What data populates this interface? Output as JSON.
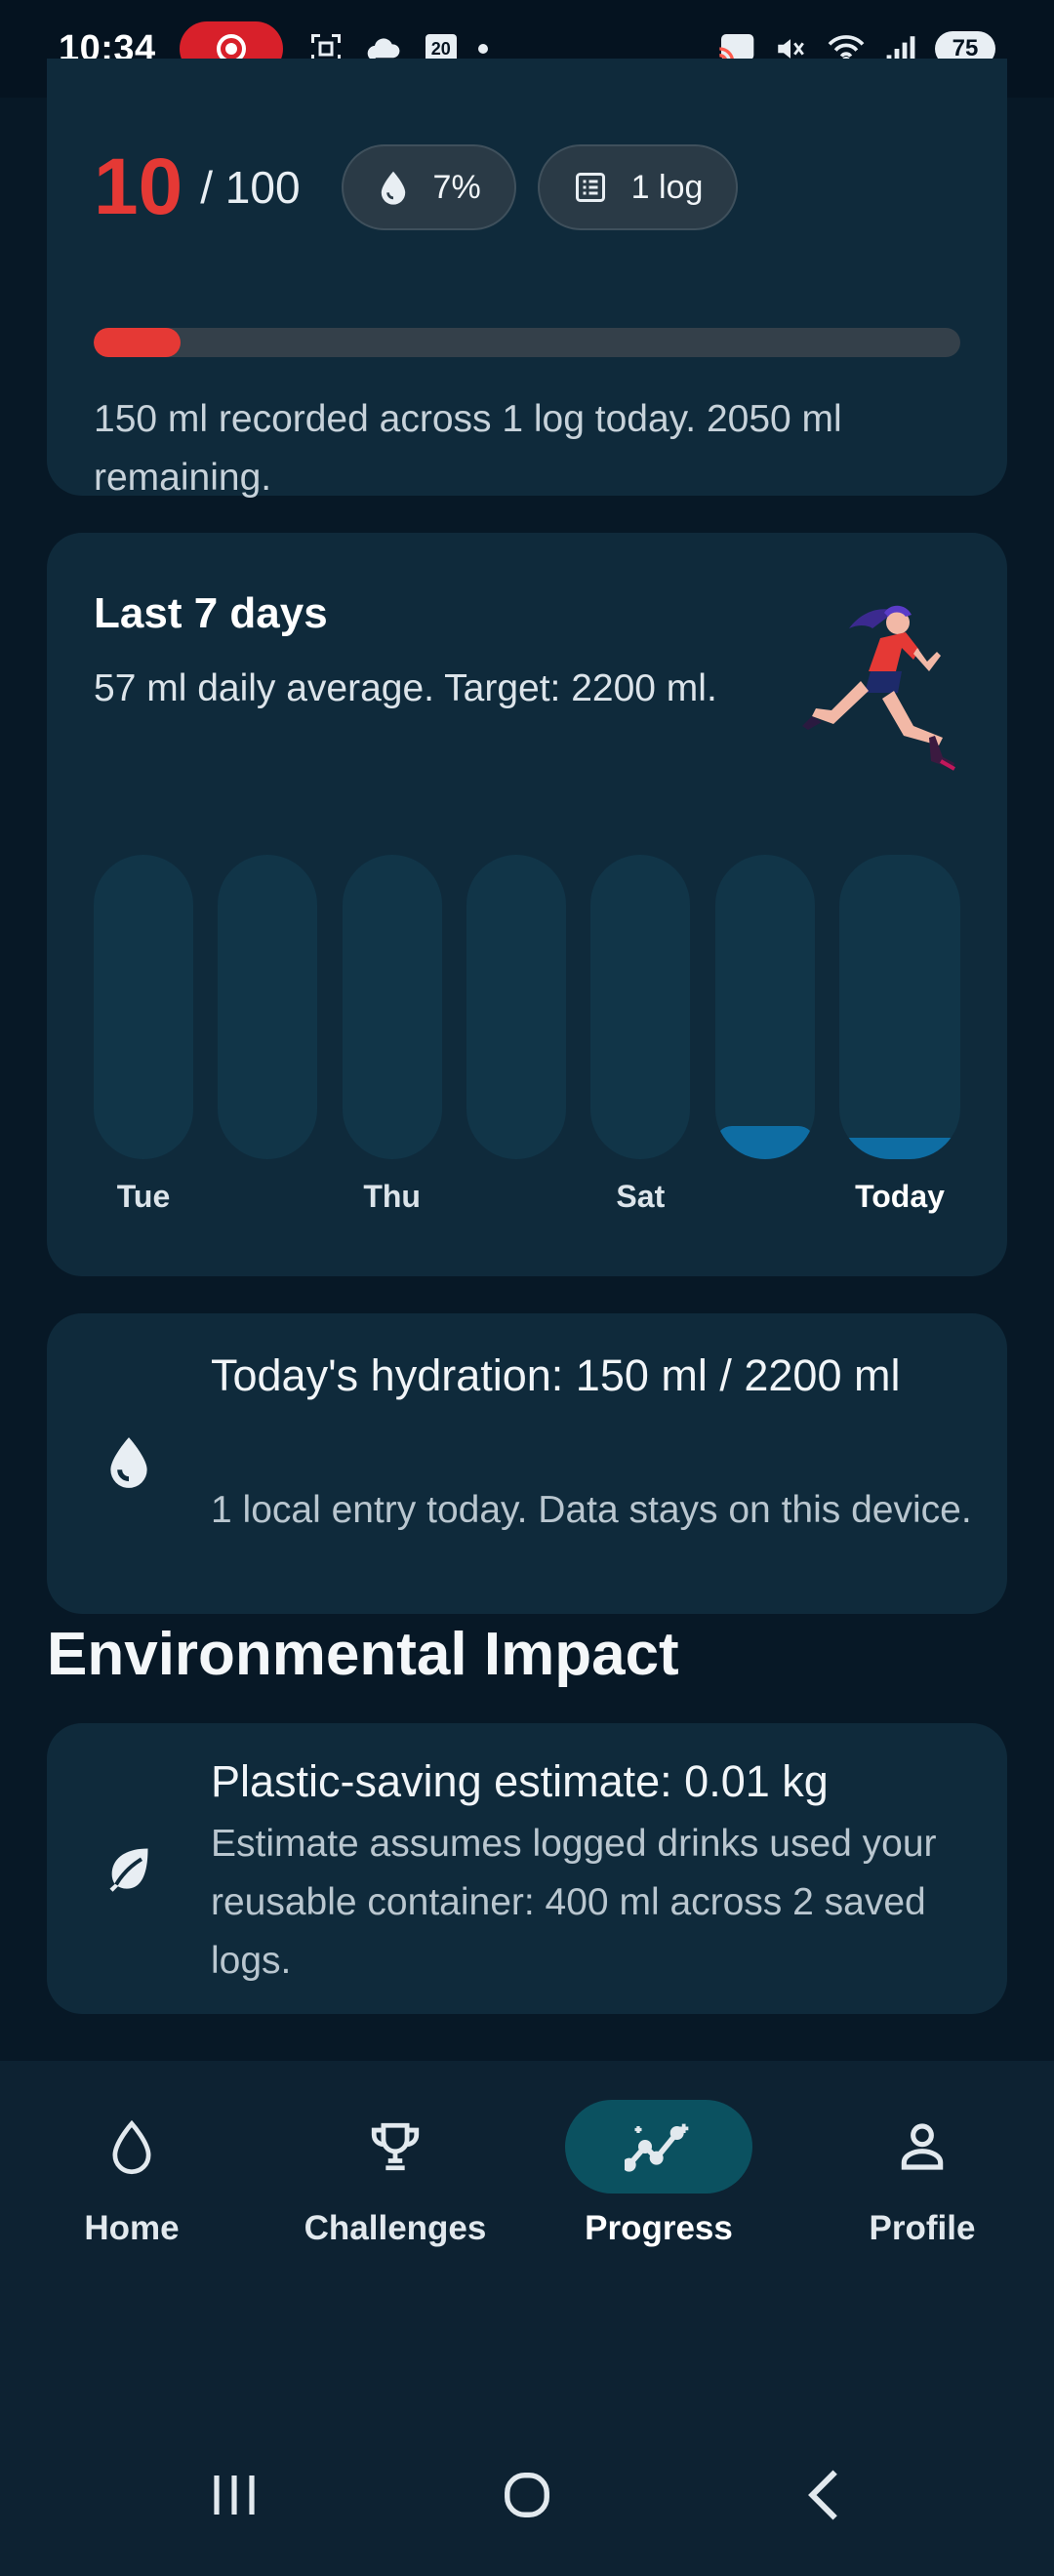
{
  "status_bar": {
    "time": "10:34",
    "calendar_day": "20",
    "battery": "75",
    "wifi_label": "6"
  },
  "score_card": {
    "score": "10",
    "score_total": "/ 100",
    "chip_percent": "7%",
    "chip_logs": "1 log",
    "progress_fraction": 0.1,
    "description": "150 ml recorded across 1 log today. 2050 ml remaining."
  },
  "week_card": {
    "title": "Last 7 days",
    "subtitle": "57 ml daily average. Target: 2200 ml.",
    "days": [
      {
        "label": "Tue",
        "fraction": 0
      },
      {
        "label": "",
        "fraction": 0
      },
      {
        "label": "Thu",
        "fraction": 0
      },
      {
        "label": "",
        "fraction": 0
      },
      {
        "label": "Sat",
        "fraction": 0
      },
      {
        "label": "",
        "fraction": 0.11
      },
      {
        "label": "Today",
        "fraction": 0.07
      }
    ]
  },
  "hydration_card": {
    "title": "Today's hydration: 150 ml / 2200 ml",
    "description": "1 local entry today. Data stays on this device."
  },
  "environment": {
    "heading": "Environmental Impact",
    "title": "Plastic-saving estimate: 0.01 kg",
    "description": "Estimate assumes logged drinks used your reusable container: 400 ml across 2 saved logs."
  },
  "bottom_nav": {
    "items": [
      {
        "label": "Home",
        "icon": "water-drop-icon",
        "active": false
      },
      {
        "label": "Challenges",
        "icon": "trophy-icon",
        "active": false
      },
      {
        "label": "Progress",
        "icon": "progress-chart-icon",
        "active": true
      },
      {
        "label": "Profile",
        "icon": "person-icon",
        "active": false
      }
    ]
  },
  "colors": {
    "accent_red": "#e53935",
    "bar_fill": "#0e6da3",
    "card_bg": "#0f2a3b",
    "page_bg": "#071826"
  }
}
